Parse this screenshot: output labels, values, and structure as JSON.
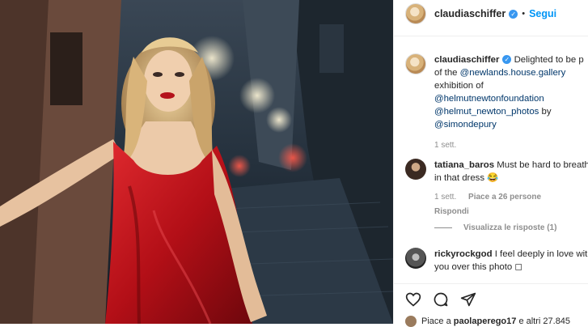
{
  "post": {
    "username": "claudiaschiffer",
    "verified_icon": "verified-check-icon",
    "separator": "•",
    "follow_label": "Segui",
    "caption_parts": [
      {
        "type": "text",
        "text": " Delighted to be p"
      },
      {
        "type": "text",
        "text": "of the "
      },
      {
        "type": "mention",
        "text": "@newlands.house.gallery"
      },
      {
        "type": "text",
        "text": " exhibition of "
      },
      {
        "type": "mention",
        "text": "@helmutnewtonfoundation"
      },
      {
        "type": "mention",
        "text": "@helmut_newton_photos"
      },
      {
        "type": "text",
        "text": " by "
      },
      {
        "type": "mention",
        "text": "@simondepury"
      }
    ],
    "caption_time": "1 sett."
  },
  "comments": [
    {
      "username": "tatiana_baros",
      "text": " Must be hard to breathe in that dress 😂",
      "time": "1 sett.",
      "likes": "Piace a 26 persone",
      "reply_label": "Rispondi"
    },
    {
      "username": "rickyrockgod",
      "text": " I feel deeply in love with you over this photo ◻"
    }
  ],
  "view_replies": "Visualizza le risposte (1)",
  "actions": {
    "like_icon": "heart-icon",
    "comment_icon": "comment-icon",
    "share_icon": "paper-plane-icon"
  },
  "likes_line": {
    "prefix": "Piace a ",
    "user": "paolaperego17",
    "suffix": " e altri 27.845"
  },
  "colors": {
    "accent": "#0095f6",
    "link": "#00376b",
    "dress": "#c0141c",
    "muted": "#8e8e8e"
  }
}
